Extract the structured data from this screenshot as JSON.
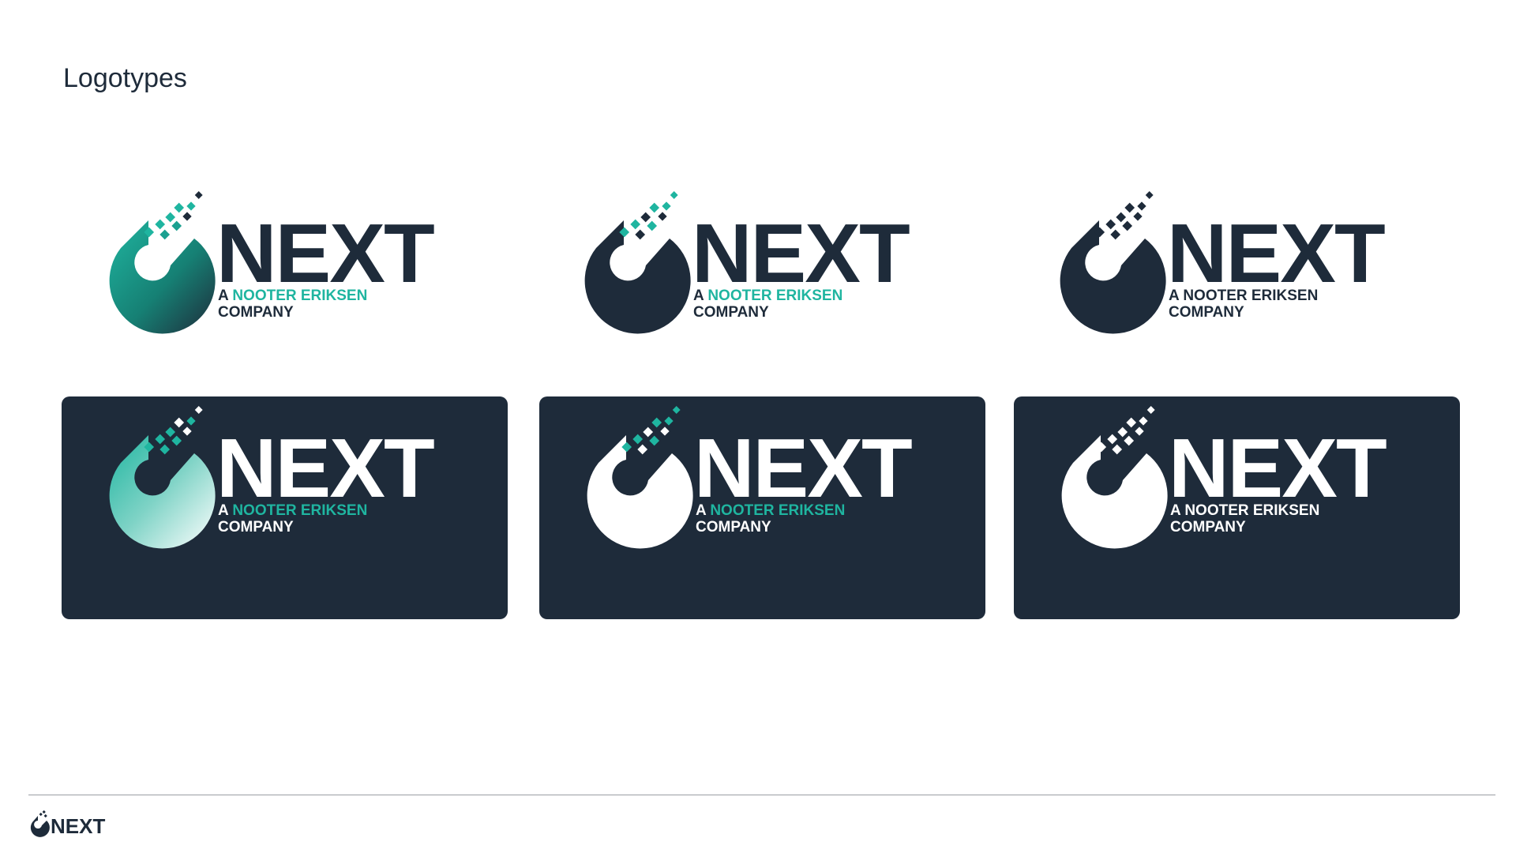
{
  "page": {
    "title": "Logotypes"
  },
  "logo": {
    "wordmark": "NEXT",
    "tagline_prefix": "A",
    "tagline_brand": "NOOTER ERIKSEN",
    "tagline_suffix": "COMPANY"
  },
  "footer": {
    "wordmark": "NEXT"
  },
  "colors": {
    "navy": "#1e2b3a",
    "teal": "#1fb5a0",
    "white": "#ffffff"
  },
  "variants": [
    {
      "name": "full-color-gradient-light",
      "background": "light"
    },
    {
      "name": "navy-with-teal-accent-light",
      "background": "light"
    },
    {
      "name": "monochrome-navy-light",
      "background": "light"
    },
    {
      "name": "gradient-on-dark",
      "background": "dark"
    },
    {
      "name": "white-with-teal-accent-dark",
      "background": "dark"
    },
    {
      "name": "monochrome-white-dark",
      "background": "dark"
    }
  ]
}
